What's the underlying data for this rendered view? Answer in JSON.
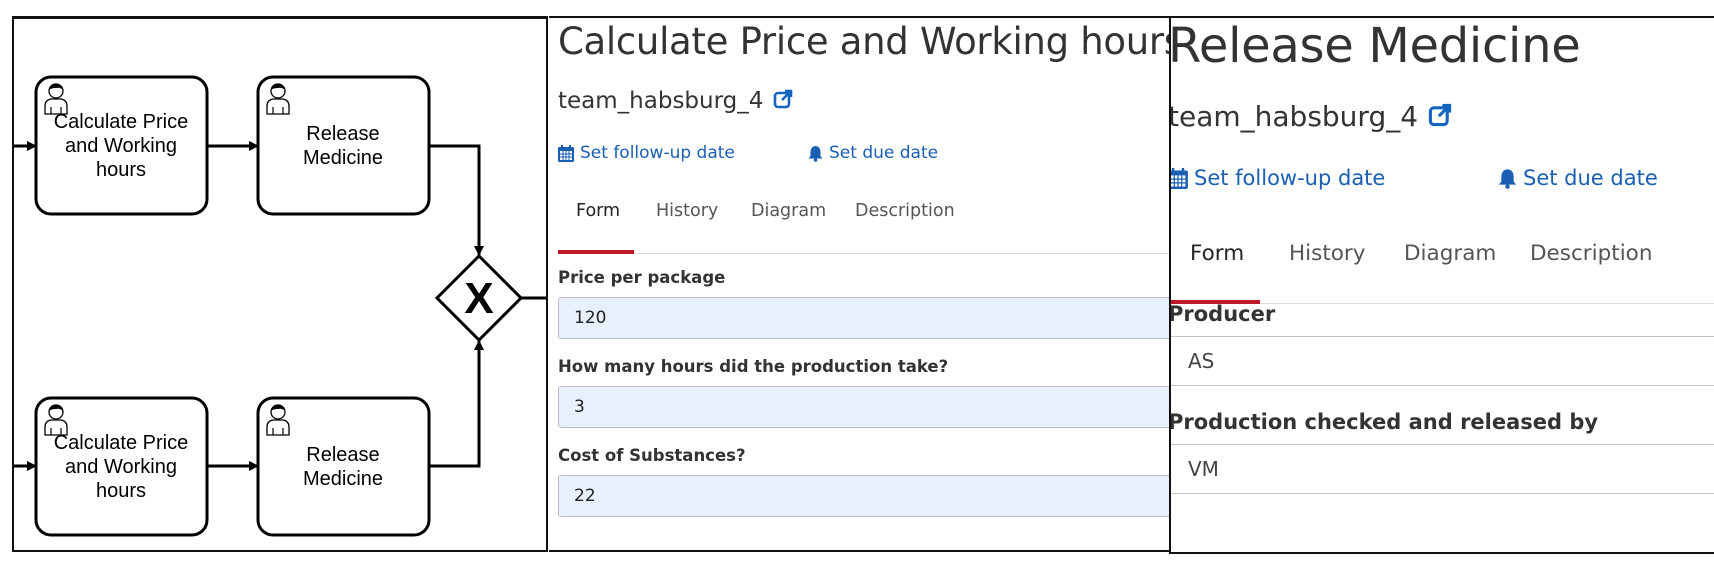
{
  "diagram": {
    "tasks": [
      {
        "lines": [
          "Calculate Price",
          "and Working",
          "hours"
        ]
      },
      {
        "lines": [
          "Release",
          "Medicine"
        ]
      },
      {
        "lines": [
          "Calculate Price",
          "and Working",
          "hours"
        ]
      },
      {
        "lines": [
          "Release",
          "Medicine"
        ]
      }
    ],
    "gateway_marker": "X"
  },
  "middle_task": {
    "title": "Calculate Price and Working hours",
    "group": "team_habsburg_4",
    "follow_up": "Set follow-up date",
    "due_date": "Set due date",
    "tabs": [
      "Form",
      "History",
      "Diagram",
      "Description"
    ],
    "active_tab": "Form",
    "fields": [
      {
        "label": "Price per package",
        "value": "120"
      },
      {
        "label": "How many hours did the production take?",
        "value": "3"
      },
      {
        "label": "Cost of Substances?",
        "value": "22"
      }
    ]
  },
  "right_task": {
    "title": "Release Medicine",
    "group": "team_habsburg_4",
    "follow_up": "Set follow-up date",
    "due_date": "Set due date",
    "tabs": [
      "Form",
      "History",
      "Diagram",
      "Description"
    ],
    "active_tab": "Form",
    "fields": [
      {
        "label": "Producer",
        "value": "AS"
      },
      {
        "label": "Production checked and released by",
        "value": "VM"
      }
    ]
  },
  "colors": {
    "accent_red": "#c0182b",
    "link_blue": "#1a5fb4",
    "input_fill": "#e8f0fe"
  },
  "icons": [
    "user-icon",
    "external-link-icon",
    "calendar-icon",
    "bell-icon"
  ]
}
